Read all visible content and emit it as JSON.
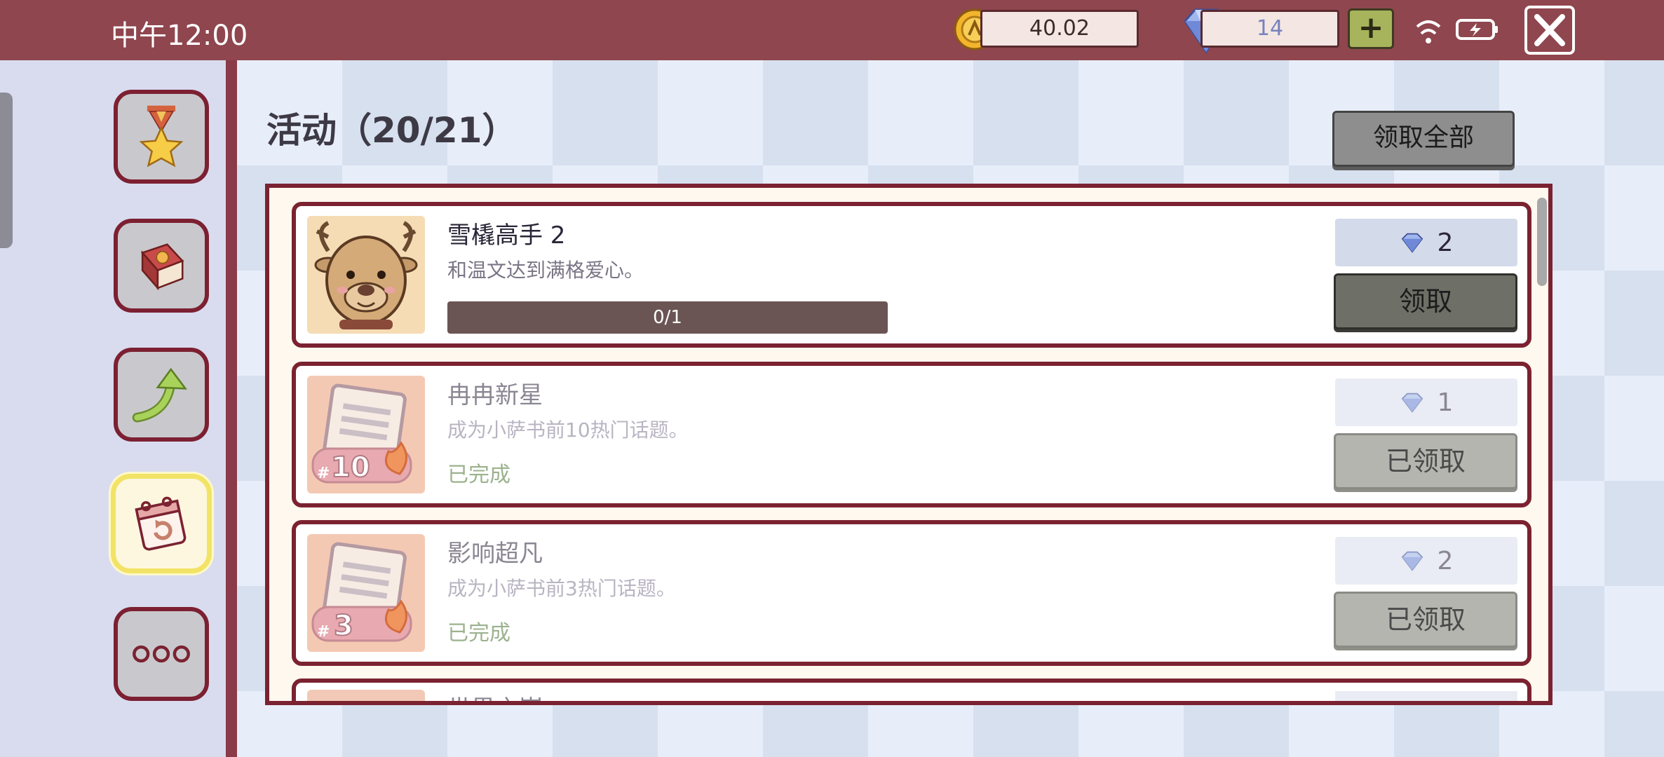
{
  "status_bar": {
    "time": "中午12:00"
  },
  "currency": {
    "coins": "40.02",
    "gems": "14",
    "add_label": "+"
  },
  "header": {
    "title": "活动（20/21）",
    "claim_all_label": "领取全部"
  },
  "tasks": [
    {
      "name": "雪橇高手 2",
      "description": "和温文达到满格爱心。",
      "progress": "0/1",
      "reward": "2",
      "button": "领取",
      "state": "claimable"
    },
    {
      "name": "冉冉新星",
      "description": "成为小萨书前10热门话题。",
      "status": "已完成",
      "reward": "1",
      "button": "已领取",
      "badge": "#10",
      "state": "claimed"
    },
    {
      "name": "影响超凡",
      "description": "成为小萨书前3热门话题。",
      "status": "已完成",
      "reward": "2",
      "button": "已领取",
      "badge": "#3",
      "state": "claimed"
    },
    {
      "name": "世界之巅",
      "state": "partially-visible"
    }
  ],
  "sidebar": {
    "items": [
      {
        "icon": "medal-star-icon"
      },
      {
        "icon": "book-icon"
      },
      {
        "icon": "arrow-up-icon"
      },
      {
        "icon": "calendar-refresh-icon",
        "active": true
      },
      {
        "icon": "more-icon"
      }
    ]
  },
  "colors": {
    "topbar": "#8f464e",
    "accent_border": "#7b2231",
    "active_highlight": "#f2e366",
    "completed_text": "#9bb28e"
  }
}
